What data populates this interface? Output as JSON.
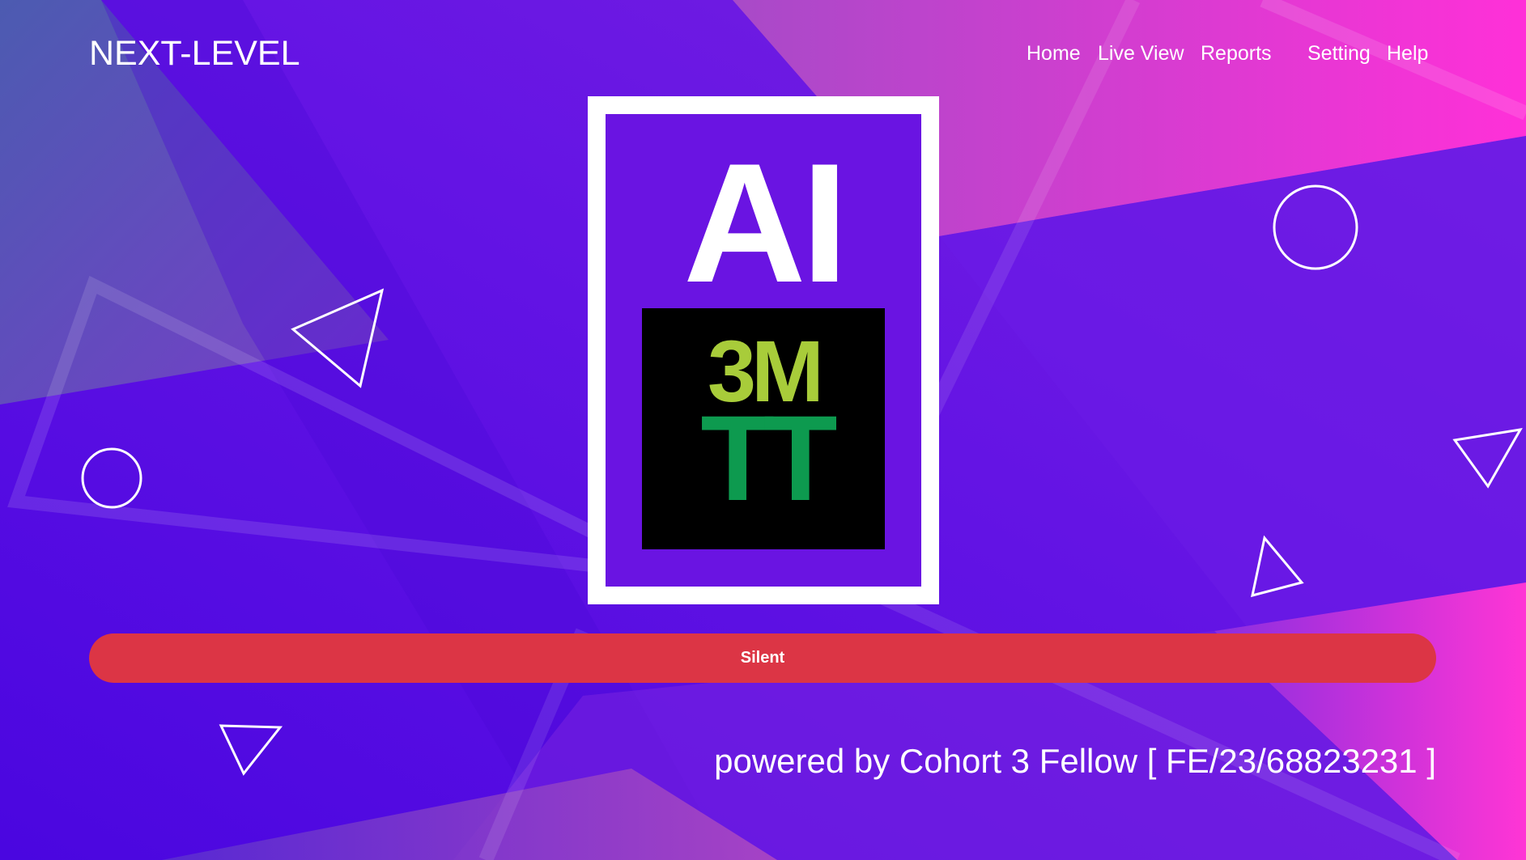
{
  "header": {
    "brand": "NEXT-LEVEL",
    "nav": [
      "Home",
      "Live View",
      "Reports",
      "Setting",
      "Help"
    ]
  },
  "logo": {
    "ai_text": "AI",
    "badge_top": "3M",
    "badge_bottom": "TT",
    "colors": {
      "frame": "#ffffff",
      "inner": "#6a14e2",
      "badge_bg": "#000000",
      "badge_top": "#a8cc3a",
      "badge_bottom": "#0d9a4f"
    }
  },
  "status_button": {
    "label": "Silent",
    "color": "#dc3545"
  },
  "footer": {
    "text": "powered by Cohort 3 Fellow [ FE/23/68823231 ]"
  },
  "theme": {
    "bg_violet": "#5a10e6",
    "bg_purple": "#7a20e0",
    "bg_pink": "#f535d8",
    "bg_slate": "#4a5aaa"
  }
}
